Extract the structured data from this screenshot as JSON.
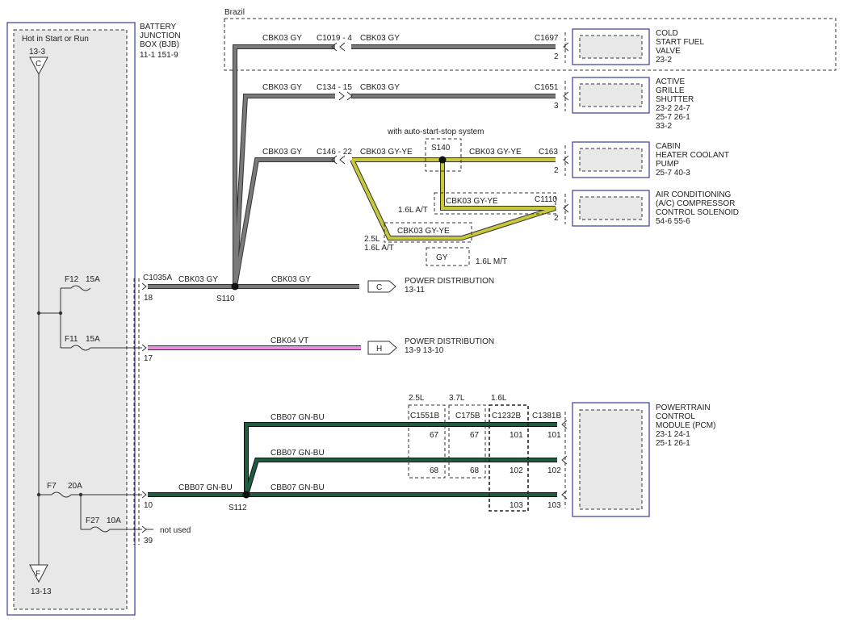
{
  "colors": {
    "gray_wire": "#7a7a7a",
    "gray_edge": "#333333",
    "gy_ye_wire": "#c8c83a",
    "vt_wire": "#e58fe0",
    "gn_bu_wire": "#1f5c40",
    "module_border": "#3a3aa0",
    "panel_fill": "#e8e8e8"
  },
  "left_panel": {
    "hot_label": "Hot in Start or Run",
    "top_ref": "13-3",
    "top_letter": "C",
    "bottom_letter": "F",
    "bottom_ref": "13-13"
  },
  "bjb": {
    "line1": "BATTERY",
    "line2": "JUNCTION",
    "line3": "BOX (BJB)",
    "refs": "11-1    151-9"
  },
  "brazil_label": "Brazil",
  "fuses": {
    "f12": {
      "name": "F12",
      "amp": "15A"
    },
    "f11": {
      "name": "F11",
      "amp": "15A"
    },
    "f7": {
      "name": "F7",
      "amp": "20A"
    },
    "f27": {
      "name": "F27",
      "amp": "10A"
    }
  },
  "pins": {
    "p18": "18",
    "p17": "17",
    "p10": "10",
    "p39": "39",
    "not_used": "not used"
  },
  "splices": {
    "s110": "S110",
    "s112": "S112",
    "s140": "S140"
  },
  "wires": {
    "cbk03_gy": "CBK03   GY",
    "cbk03_gyye": "CBK03   GY-YE",
    "cbk04_vt": "CBK04   VT",
    "cbb07_gnbu": "CBB07   GN-BU",
    "gy": "GY"
  },
  "connectors": {
    "c1035a": "C1035A",
    "c1019": "C1019 - 4",
    "c134": "C134 - 15",
    "c146": "C146 - 22",
    "c1697": "C1697",
    "c1651": "C1651",
    "c163": "C163",
    "c1110": "C1110",
    "c1551b": "C1551B",
    "c175b": "C175B",
    "c1232b": "C1232B",
    "c1381b": "C1381B"
  },
  "options": {
    "auto_start_stop": "with auto-start-stop system",
    "l16_at": "1.6L A/T",
    "l25": "2.5L",
    "l16_at2": "1.6L A/T",
    "l16_mt": "1.6L M/T",
    "h25": "2.5L",
    "h37": "3.7L",
    "h16": "1.6L"
  },
  "components": {
    "cold_start": {
      "l1": "COLD",
      "l2": "START FUEL",
      "l3": "VALVE",
      "refs": "23-2",
      "pin": "2"
    },
    "grille": {
      "l1": "ACTIVE",
      "l2": "GRILLE",
      "l3": "SHUTTER",
      "r1": "23-2    24-7",
      "r2": "25-7    26-1",
      "r3": "33-2",
      "pin": "3"
    },
    "cabin": {
      "l1": "CABIN",
      "l2": "HEATER COOLANT",
      "l3": "PUMP",
      "refs": "25-7    40-3",
      "pin": "2"
    },
    "ac": {
      "l1": "AIR CONDITIONING",
      "l2": "(A/C) COMPRESSOR",
      "l3": "CONTROL SOLENOID",
      "refs": "54-6    55-6",
      "pin": "2"
    },
    "pcm": {
      "l1": "POWERTRAIN",
      "l2": "CONTROL",
      "l3": "MODULE (PCM)",
      "r1": "23-1    24-1",
      "r2": "25-1    26-1"
    }
  },
  "power_dist": {
    "c": {
      "letter": "C",
      "title": "POWER DISTRIBUTION",
      "refs": "13-11"
    },
    "h": {
      "letter": "H",
      "title": "POWER DISTRIBUTION",
      "refs": "13-9    13-10"
    }
  },
  "pin_table": {
    "row1": [
      "67",
      "67",
      "101",
      "101"
    ],
    "row2": [
      "68",
      "68",
      "102",
      "102"
    ],
    "row3": [
      "103",
      "103"
    ]
  }
}
